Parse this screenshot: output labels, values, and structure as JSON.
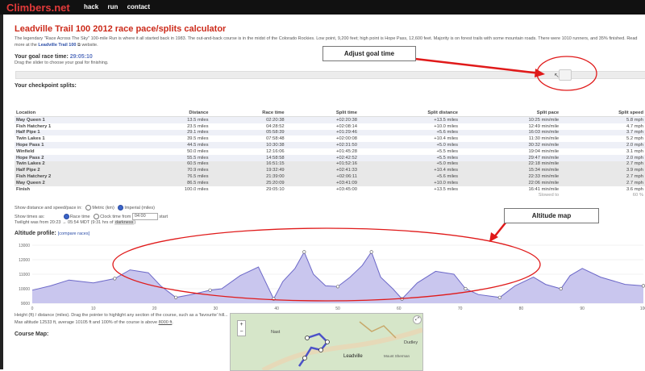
{
  "site": {
    "logo": "Climbers.net",
    "nav": [
      "hack",
      "run",
      "contact"
    ]
  },
  "title": "Leadville Trail 100 2012 race pace/splits calculator",
  "intro_text": "The legendary \"Race Across The Sky\" 100-mile Run is where it all started back in 1983. The out-and-back course is in the midst of the Colorado Rockies. Low point, 9,200 feet; high point is Hope Pass, 12,600 feet. Majority is on forest trails with some mountain roads. There were 1010 runners, and 35% finished. Read more at the",
  "intro_link": "Leadville Trail 100",
  "intro_suffix": "website.",
  "goal": {
    "label": "Your goal race time:",
    "value": "29:05:10",
    "hint": "Drag the slider to choose your goal for finishing.",
    "slider_fraction": 0.88
  },
  "splits_heading": "Your checkpoint splits:",
  "table": {
    "headers": [
      "Location",
      "Distance",
      "Race time",
      "Split time",
      "Split distance",
      "Split pace",
      "Split speed"
    ],
    "rows": [
      [
        "May Queen 1",
        "13.5 miles",
        "02:20:38",
        "+02:20:38",
        "+13.5 miles",
        "10:25 min/mile",
        "5.8 mph"
      ],
      [
        "Fish Hatchery 1",
        "23.5 miles",
        "04:28:52",
        "+02:08:14",
        "+10.0 miles",
        "12:49 min/mile",
        "4.7 mph"
      ],
      [
        "Half Pipe 1",
        "29.1 miles",
        "05:58:39",
        "+01:29:46",
        "+5.6 miles",
        "16:03 min/mile",
        "3.7 mph"
      ],
      [
        "Twin Lakes 1",
        "39.5 miles",
        "07:58:48",
        "+02:00:08",
        "+10.4 miles",
        "11:30 min/mile",
        "5.2 mph"
      ],
      [
        "Hope Pass 1",
        "44.5 miles",
        "10:30:38",
        "+02:31:50",
        "+5.0 miles",
        "30:32 min/mile",
        "2.0 mph"
      ],
      [
        "Winfield",
        "50.0 miles",
        "12:16:06",
        "+01:45:28",
        "+5.5 miles",
        "19:04 min/mile",
        "3.1 mph"
      ],
      [
        "Hope Pass 2",
        "55.5 miles",
        "14:58:58",
        "+02:42:52",
        "+5.5 miles",
        "29:47 min/mile",
        "2.0 mph"
      ],
      [
        "Twin Lakes 2",
        "60.5 miles",
        "16:51:15",
        "+01:52:16",
        "+5.0 miles",
        "22:18 min/mile",
        "2.7 mph"
      ],
      [
        "Half Pipe 2",
        "70.9 miles",
        "19:32:49",
        "+02:41:33",
        "+10.4 miles",
        "15:34 min/mile",
        "3.9 mph"
      ],
      [
        "Fish Hatchery 2",
        "76.5 miles",
        "21:39:00",
        "+02:06:11",
        "+5.6 miles",
        "22:33 min/mile",
        "2.7 mph"
      ],
      [
        "May Queen 2",
        "86.5 miles",
        "25:20:09",
        "+03:41:09",
        "+10.0 miles",
        "22:06 min/mile",
        "2.7 mph"
      ],
      [
        "Finish",
        "100.0 miles",
        "29:05:10",
        "+03:45:00",
        "+13.5 miles",
        "16:41 min/mile",
        "3.6 mph"
      ]
    ],
    "footer_pace": "Slowed to",
    "footer_speed": "60 %"
  },
  "options": {
    "distance_label": "Show distance and speed/pace in:",
    "metric": "Metric (km)",
    "imperial": "Imperial (miles)",
    "times_label": "Show times as:",
    "race_time": "Race time",
    "clock_time": "Clock time from",
    "clock_value": "04:00",
    "start": "start",
    "twilight": "Twilight was from 20:23 → 05:54 MDT (9:31 hrs of",
    "darkness": "darkness",
    "twilight_end": ")"
  },
  "profile": {
    "title": "Altitude profile:",
    "compare_link": "[compare races]",
    "caption1": "Height (ft) / distance (miles). Drag the pointer to highlight any section of the course, such as a 'favourite' hill...",
    "caption2": "Max altitude 12533 ft, average 10105 ft and 100% of the course is above",
    "caption2_value": "8000 ft",
    "caption2_end": "."
  },
  "chart_data": {
    "type": "area",
    "x": [
      0,
      3,
      6,
      10,
      13.5,
      16,
      19,
      21,
      23.5,
      26,
      29.1,
      31,
      34,
      37,
      39.5,
      41,
      43,
      44.5,
      46,
      48,
      50,
      52,
      54,
      55.5,
      57,
      59,
      60.5,
      63,
      66,
      69,
      70.9,
      73,
      76.5,
      79,
      82,
      84,
      86.5,
      88,
      90,
      93,
      97,
      100
    ],
    "y": [
      9900,
      10200,
      10600,
      10400,
      10700,
      11300,
      11100,
      10200,
      9400,
      9600,
      9900,
      10000,
      10900,
      11500,
      9300,
      10500,
      11400,
      12533,
      11000,
      10200,
      10150,
      10800,
      11600,
      12533,
      10800,
      10000,
      9300,
      10400,
      11200,
      11000,
      10000,
      9600,
      9400,
      10200,
      10800,
      10300,
      10000,
      10900,
      11400,
      10800,
      10300,
      10200
    ],
    "markers_x": [
      13.5,
      23.5,
      29.1,
      39.5,
      44.5,
      50,
      55.5,
      60.5,
      70.9,
      76.5,
      86.5,
      100
    ],
    "ylim": [
      9000,
      13000
    ],
    "yticks": [
      "13000",
      "12000",
      "11000",
      "10000",
      "9000"
    ],
    "xlim": [
      0,
      100
    ],
    "xticks": [
      "0",
      "10",
      "20",
      "30",
      "40",
      "50",
      "60",
      "70",
      "80",
      "90",
      "100"
    ],
    "fill_color": "#c9c6ee",
    "line_color": "#6c68c8"
  },
  "annotations": {
    "goal_callout": "Adjust goal time",
    "altitude_callout": "Altitude map",
    "arrow_color": "#e01a1a"
  },
  "course_map": {
    "heading": "Course Map:",
    "labels": [
      "Nast",
      "Leadville",
      "Dudley",
      "Mount Sherman"
    ]
  }
}
